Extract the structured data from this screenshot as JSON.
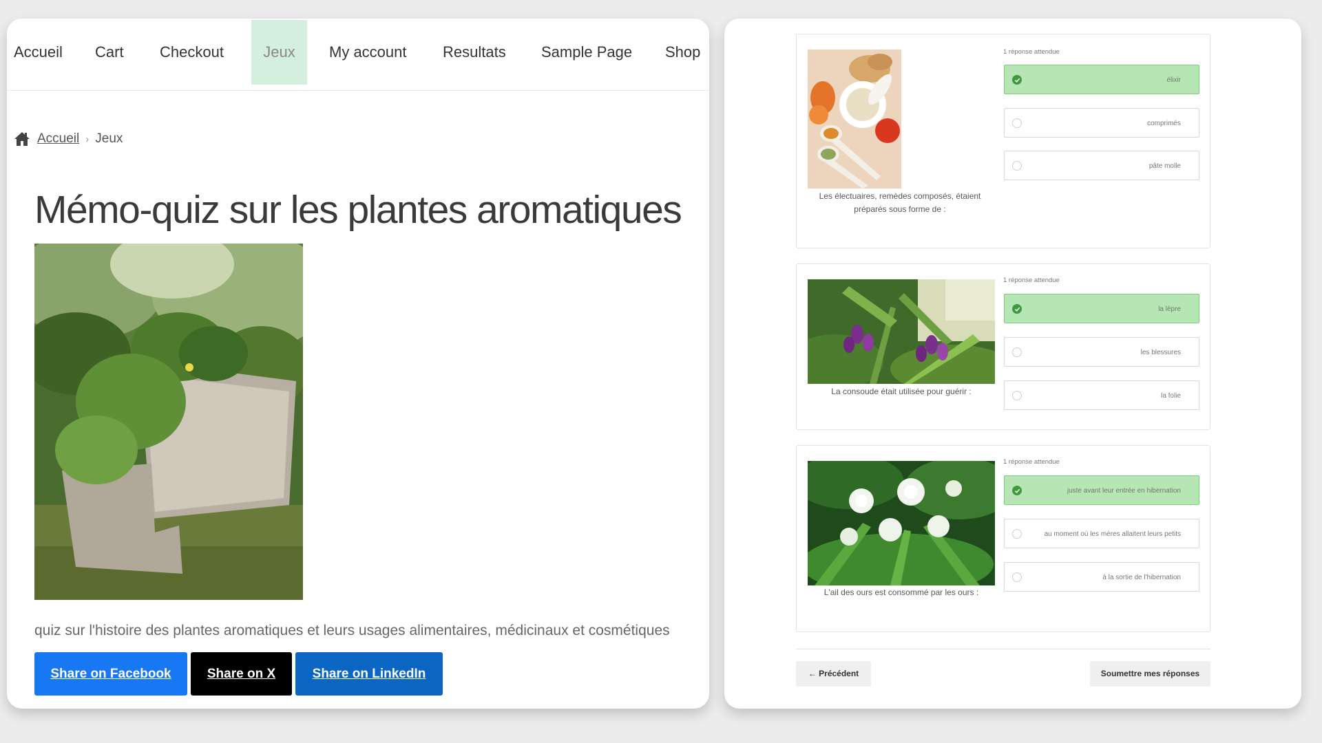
{
  "nav": {
    "items": [
      {
        "label": "Accueil"
      },
      {
        "label": "Cart"
      },
      {
        "label": "Checkout"
      },
      {
        "label": "Jeux"
      },
      {
        "label": "My account"
      },
      {
        "label": "Resultats"
      },
      {
        "label": "Sample Page"
      },
      {
        "label": "Shop"
      }
    ],
    "active": "Jeux"
  },
  "breadcrumb": {
    "home_label": "Accueil",
    "separator": "›",
    "current": "Jeux",
    "icon": "home-icon"
  },
  "page": {
    "title": "Mémo-quiz sur les plantes aromatiques",
    "description": "quiz sur l'histoire des plantes aromatiques et leurs usages alimentaires, médicinaux et cosmétiques"
  },
  "share": {
    "facebook": {
      "label": "Share on Facebook",
      "color": "#1877f2"
    },
    "x": {
      "label": "Share on X",
      "color": "#000000"
    },
    "linkedin": {
      "label": "Share on LinkedIn",
      "color": "#0a66c2"
    }
  },
  "quiz": {
    "questions": [
      {
        "hint": "1 réponse attendue",
        "question": "Les électuaires, remèdes composés, étaient préparés sous forme de :",
        "options": [
          {
            "label": "élixir",
            "selected": true
          },
          {
            "label": "comprimés",
            "selected": false
          },
          {
            "label": "pâte molle",
            "selected": false
          }
        ]
      },
      {
        "hint": "1 réponse attendue",
        "question": "La consoude était utilisée pour guérir :",
        "options": [
          {
            "label": "la lèpre",
            "selected": true
          },
          {
            "label": "les blessures",
            "selected": false
          },
          {
            "label": "la folie",
            "selected": false
          }
        ]
      },
      {
        "hint": "1 réponse attendue",
        "question": "L'ail des ours est consommé par les ours :",
        "options": [
          {
            "label": "juste avant leur entrée en hibernation",
            "selected": true
          },
          {
            "label": "au moment où les mères allaitent leurs petits",
            "selected": false
          },
          {
            "label": "à la sortie de l'hibernation",
            "selected": false
          }
        ]
      }
    ],
    "prev_label": "← Précédent",
    "submit_label": "Soumettre mes réponses"
  },
  "colors": {
    "nav_active_bg": "#d4efde",
    "selected_option_bg": "#b7e6b5",
    "check_green": "#3f9a3d"
  }
}
